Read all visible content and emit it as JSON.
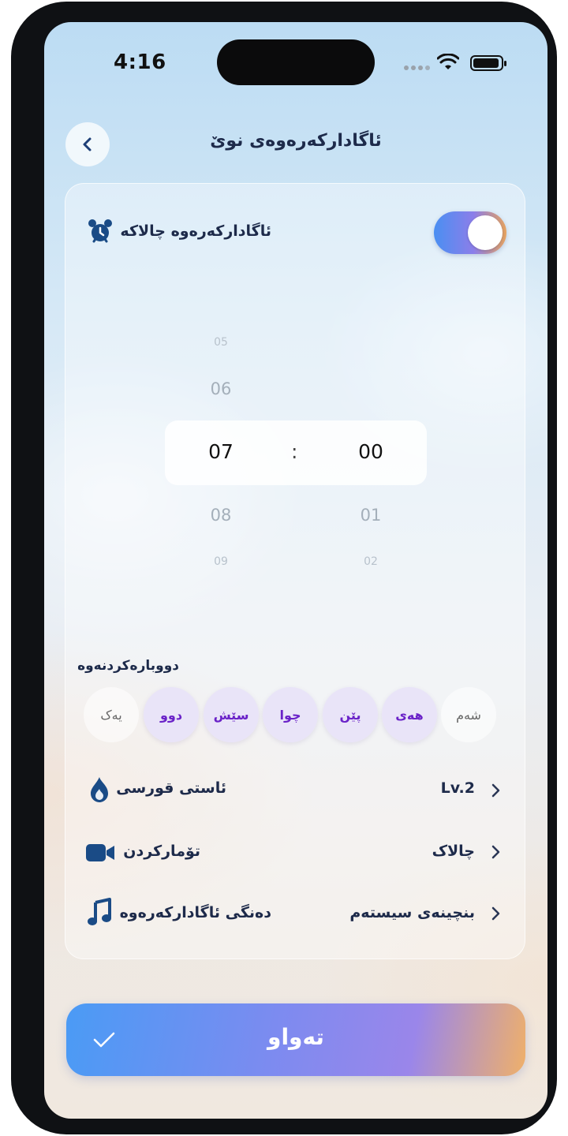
{
  "status": {
    "time": "4:16"
  },
  "header": {
    "title": "ئاگادارکەرەوەی نوێ"
  },
  "alarm": {
    "label": "ئاگادارکەرەوە چالاکە",
    "enabled": true
  },
  "picker": {
    "hours_above": [
      "05",
      "06"
    ],
    "hour_selected": "07",
    "hours_below": [
      "08",
      "09"
    ],
    "minute_selected": "00",
    "minutes_below": [
      "01",
      "02"
    ],
    "separator": ":"
  },
  "repeat": {
    "title": "دووبارەکردنەوە",
    "days": [
      {
        "label": "یەک",
        "selected": false
      },
      {
        "label": "دوو",
        "selected": true
      },
      {
        "label": "سێش",
        "selected": true
      },
      {
        "label": "چوا",
        "selected": true
      },
      {
        "label": "پێن",
        "selected": true
      },
      {
        "label": "هەی",
        "selected": true
      },
      {
        "label": "شەم",
        "selected": false
      }
    ]
  },
  "settings": [
    {
      "label": "ئاستی قورسی",
      "value": "Lv.2",
      "icon": "flame-icon"
    },
    {
      "label": "تۆمارکردن",
      "value": "چالاک",
      "icon": "video-camera-icon"
    },
    {
      "label": "دەنگی ئاگادارکەرەوە",
      "value": "بنچینەی سیستەم",
      "icon": "music-note-icon"
    }
  ],
  "done": {
    "label": "تەواو"
  },
  "colors": {
    "accent": "#4a8ff2",
    "accent_end": "#e6a25e",
    "text": "#1d2a4a",
    "day_selected_text": "#6a22c8"
  }
}
